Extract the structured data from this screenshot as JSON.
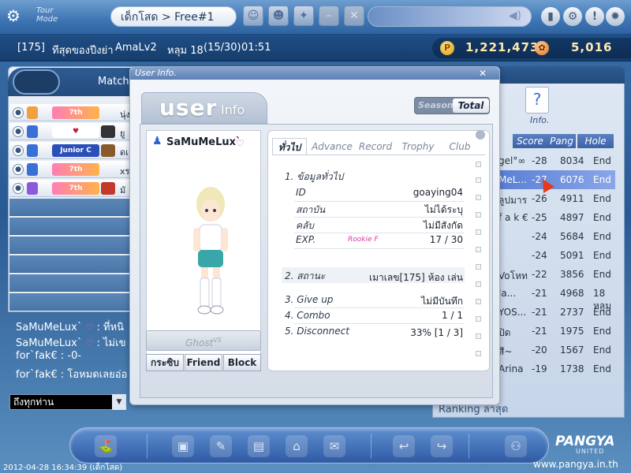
{
  "topbar": {
    "logo_text": "Tour Mode",
    "channel": "เด็กโสด > Free#1"
  },
  "infobar": {
    "room_no": "[175]",
    "room_name": "ทีสุดของปีงย่า",
    "course": "AmaLv2",
    "hole": "หลุม 18",
    "progress": "(15/30)",
    "time": "01:51",
    "pang": "1,221,473",
    "cookie": "5,016"
  },
  "left": {
    "match_label": "Match",
    "players": [
      {
        "name": "นุ่ง"
      },
      {
        "name": "ยู"
      },
      {
        "name": "ดเ"
      },
      {
        "name": "xร"
      },
      {
        "name": "มั"
      }
    ],
    "chat": [
      {
        "user": "SaMuMeLux`",
        "text": ": ที่หนิ"
      },
      {
        "user": "SaMuMeLux`",
        "text": ": ไม่เข"
      },
      {
        "user": "for`fak€",
        "text": ": -0-"
      },
      {
        "user": "for`fak€",
        "text": ": โอหมดเลยอ่อ"
      }
    ],
    "chat_target": "ถึงทุกท่าน"
  },
  "popup": {
    "title": "User Info.",
    "tab_user": "user",
    "tab_info": "Info",
    "season": "Season",
    "total": "Total",
    "player_name": "SaMuMeLux`",
    "ghost": "Ghost",
    "ghost_sup": "VS",
    "buttons": [
      "กระซิบ",
      "Friend",
      "Block"
    ],
    "tabs": [
      "ทั่วไป",
      "Advance",
      "Record",
      "Trophy",
      "Club"
    ],
    "sec1": "1. ข้อมูลทั่วไป",
    "id_key": "ID",
    "id_val": "goaying04",
    "place_key": "สถาบัน",
    "place_val": "ไม่ได้ระบุ",
    "club_key": "คลับ",
    "club_val": "ไม่มีสังกัด",
    "exp_key": "EXP.",
    "rank": "Rookie F",
    "exp_val": "17 / 30",
    "sec2": "2. สถานะ",
    "status_val": "เมาเลข[175] ห้อง เล่น",
    "giveup_key": "3. Give up",
    "giveup_val": "ไม่มีบันทึก",
    "combo_key": "4. Combo",
    "combo_val": "1 / 1",
    "disc_key": "5. Disconnect",
    "disc_val": "33% [1 / 3]"
  },
  "right": {
    "info_label": "Info.",
    "headers": [
      "Score",
      "Pang",
      "Hole"
    ],
    "rows": [
      {
        "name": "gel°∞",
        "score": "-28",
        "pang": "8034",
        "hole": "End"
      },
      {
        "name": "MeL...",
        "score": "-27",
        "pang": "6076",
        "hole": "End"
      },
      {
        "name": "ลูปมาร",
        "score": "-26",
        "pang": "4911",
        "hole": "End"
      },
      {
        "name": "f a k €",
        "score": "-25",
        "pang": "4897",
        "hole": "End"
      },
      {
        "name": "",
        "score": "-24",
        "pang": "5684",
        "hole": "End"
      },
      {
        "name": "",
        "score": "-24",
        "pang": "5091",
        "hole": "End"
      },
      {
        "name": "Voโหท",
        "score": "-22",
        "pang": "3856",
        "hole": "End"
      },
      {
        "name": "la...",
        "score": "-21",
        "pang": "4968",
        "hole": "18 หลุม"
      },
      {
        "name": "YOS...",
        "score": "-21",
        "pang": "2737",
        "hole": "End"
      },
      {
        "name": "ปิด",
        "score": "-21",
        "pang": "1975",
        "hole": "End"
      },
      {
        "name": "สี~",
        "score": "-20",
        "pang": "1567",
        "hole": "End"
      },
      {
        "name": "Arina",
        "score": "-19",
        "pang": "1738",
        "hole": "End"
      }
    ],
    "ranking": "Ranking ล่าสุด"
  },
  "bottom": {
    "pangya": "PANGYA",
    "pangya_sub": "UNITED",
    "url": "www.pangya.in.th",
    "timestamp": "2012-04-28 16:34:39 (เด็กโสด)"
  },
  "icons": {
    "logo": "caddie-icon",
    "top": [
      "character-icon",
      "character2-icon",
      "item-icon",
      "minus-icon",
      "close-icon"
    ],
    "sys": [
      "phone-icon",
      "network-icon",
      "help-icon",
      "settings-icon"
    ]
  }
}
